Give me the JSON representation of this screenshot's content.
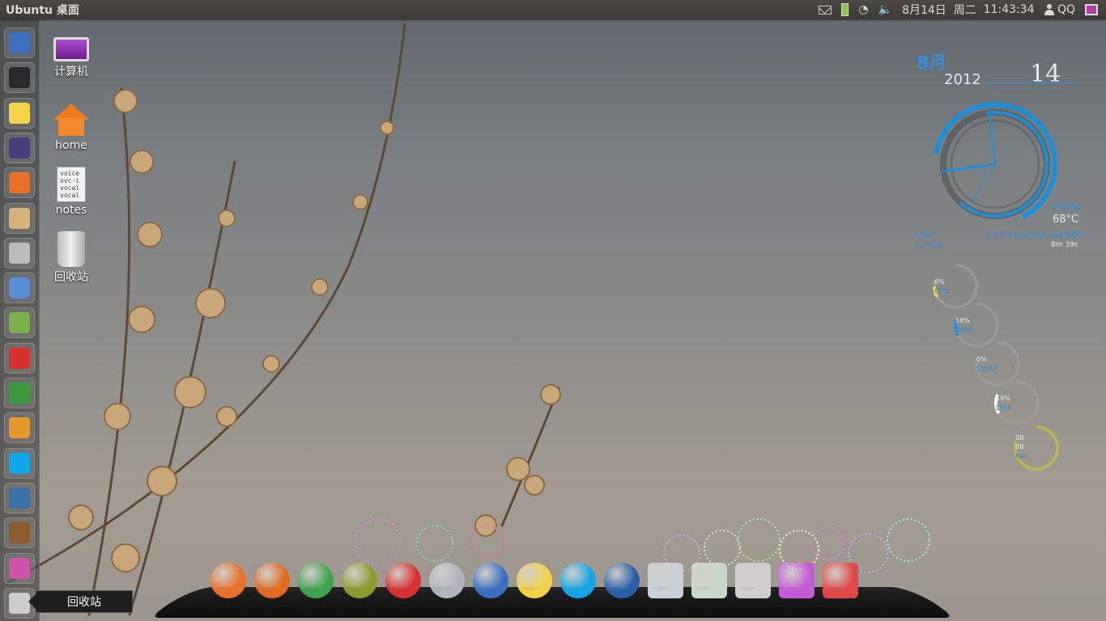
{
  "topbar": {
    "app_title": "Ubuntu 桌面",
    "date": "8月14日",
    "weekday": "周二",
    "time": "11:43:34",
    "user": "QQ",
    "indicators": [
      "mail-icon",
      "battery-icon",
      "network-icon",
      "volume-icon"
    ]
  },
  "launcher": {
    "items": [
      {
        "name": "virtualbox",
        "color": "#3a6fbf"
      },
      {
        "name": "system-monitor",
        "color": "#2a2a2a"
      },
      {
        "name": "qq-mail",
        "color": "#f5d44a"
      },
      {
        "name": "night-screensaver",
        "color": "#4b3c7c"
      },
      {
        "name": "software-center",
        "color": "#e8702a"
      },
      {
        "name": "archive-manager",
        "color": "#d6b37a"
      },
      {
        "name": "help",
        "color": "#bbbbbb"
      },
      {
        "name": "favorites",
        "color": "#5a8fd8"
      },
      {
        "name": "finance",
        "color": "#79b04a"
      },
      {
        "name": "miro",
        "color": "#d83030"
      },
      {
        "name": "gvim",
        "color": "#3c9a3c"
      },
      {
        "name": "password-keyring",
        "color": "#e39a2b"
      },
      {
        "name": "skype",
        "color": "#12a5e8"
      },
      {
        "name": "image-viewer",
        "color": "#3d6fa8"
      },
      {
        "name": "library",
        "color": "#8c5a2c"
      },
      {
        "name": "presentation",
        "color": "#cc55aa"
      },
      {
        "name": "trash",
        "color": "#cccccc"
      }
    ],
    "tooltip": "回收站"
  },
  "desktop_icons": [
    {
      "label": "计算机"
    },
    {
      "label": "home"
    },
    {
      "label": "notes",
      "preview": "voice\novc-i\nvocal\nvocal"
    },
    {
      "label": "回收站"
    }
  ],
  "widgets": {
    "clock_month": "8月",
    "year": "2012",
    "day": "14",
    "location": "Home",
    "temp": "68°C",
    "os_label": "Linux",
    "kernel": "3.2.0-23-generic-pae i686",
    "uptime_label": "Uptime:",
    "uptime": "8m 39s",
    "meters": [
      {
        "value": "8%",
        "label": "CPU",
        "fraction": 0.08
      },
      {
        "value": "16%",
        "label": "RAM",
        "fraction": 0.16
      },
      {
        "value": "0%",
        "label": "SWAP",
        "fraction": 0.0
      },
      {
        "value": "19%",
        "label": "Disk",
        "fraction": 0.19
      },
      {
        "value": "0B\n0B",
        "label": "Net",
        "fraction": 0.0
      }
    ]
  },
  "dock": {
    "items": [
      "ubuntu-logo",
      "firefox",
      "chrome",
      "gnome-books",
      "miro",
      "cube-app",
      "virtualbox",
      "qq",
      "skype",
      "thunderbird",
      "cube-glass-1",
      "cube-glass-2",
      "file-cabinet",
      "pink-cube",
      "red-cube"
    ]
  },
  "colors": {
    "accent_blue": "#1e8fd6",
    "panel": "#3b3a36"
  }
}
